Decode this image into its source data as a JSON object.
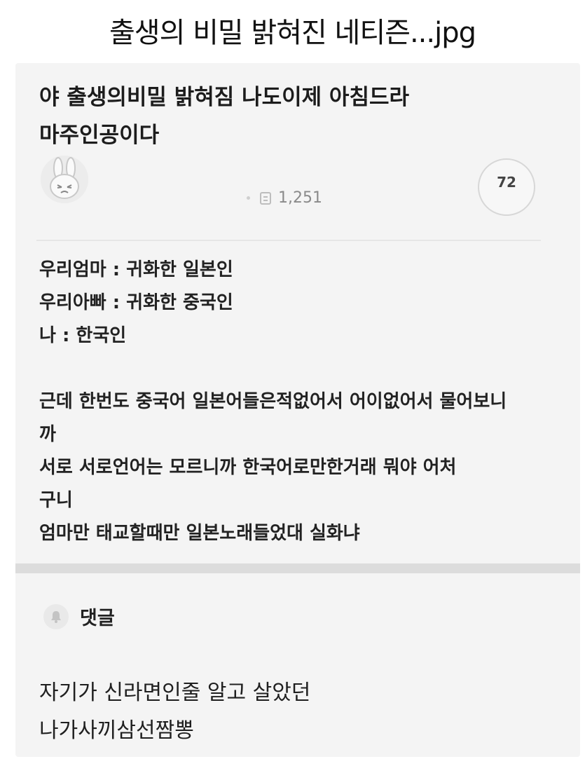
{
  "header": {
    "title": "출생의 비밀 밝혀진 네티즌...jpg"
  },
  "post": {
    "title_lines": [
      "야  출생의비밀 밝혀짐 나도이제 아침드라",
      "마주인공이다"
    ],
    "views": "1,251",
    "comment_count": "72",
    "body_lines": [
      "우리엄마 : 귀화한 일본인",
      "우리아빠 : 귀화한 중국인",
      "나 : 한국인",
      "",
      "근데 한번도 중국어 일본어들은적없어서 어이없어서 물어보니",
      "까",
      "서로 서로언어는 모르니까 한국어로만한거래 뭐야 어처",
      "구니",
      "엄마만 태교할때만 일본노래들었대 실화냐"
    ]
  },
  "comments": {
    "label": "댓글",
    "lines": [
      "자기가 신라면인줄 알고 살았던",
      "나가사끼삼선짬뽕"
    ]
  },
  "icons": {
    "avatar": "bunny-avatar-icon",
    "views": "document-icon",
    "comments": "bell-icon"
  },
  "colors": {
    "background": "#ffffff",
    "card": "#f4f4f4",
    "muted_text": "#8a8a8a",
    "separator": "#dcdcdc"
  }
}
